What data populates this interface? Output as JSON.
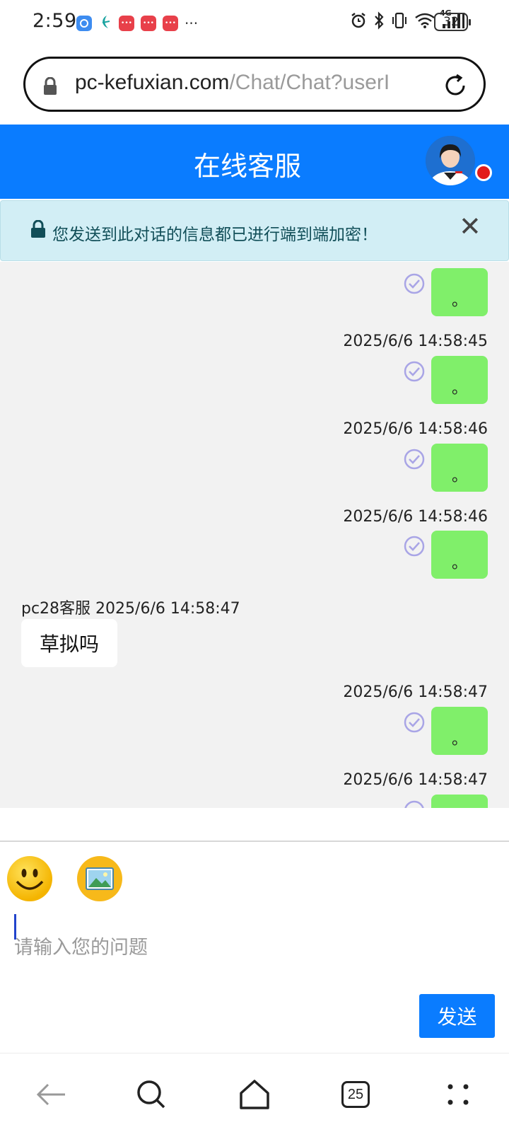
{
  "status_bar": {
    "time": "2:59",
    "network": "4G",
    "battery": "32"
  },
  "browser": {
    "url_domain": "pc-kefuxian.com",
    "url_path": "/Chat/Chat?userI",
    "tab_count": "25"
  },
  "header": {
    "title": "在线客服"
  },
  "notice": {
    "text": "您发送到此对话的信息都已进行端到端加密！",
    "close": "✕"
  },
  "chat": {
    "outgoing": [
      {
        "text": "。"
      },
      {
        "time": "2025/6/6 14:58:45",
        "text": "。"
      },
      {
        "time": "2025/6/6 14:58:46",
        "text": "。"
      },
      {
        "time": "2025/6/6 14:58:46",
        "text": "。"
      },
      {
        "time": "2025/6/6 14:58:47",
        "text": "。"
      },
      {
        "time": "2025/6/6 14:58:47",
        "text": ""
      }
    ],
    "incoming": {
      "sender_time": "pc28客服 2025/6/6 14:58:47",
      "text": "草拟吗"
    }
  },
  "composer": {
    "placeholder": "请输入您的问题",
    "send_label": "发送"
  },
  "colors": {
    "brand_blue": "#0a7cff",
    "outgoing_bubble": "#80ef6a",
    "notice_bg": "#d2eef5",
    "online_dot": "#e21b1b"
  }
}
